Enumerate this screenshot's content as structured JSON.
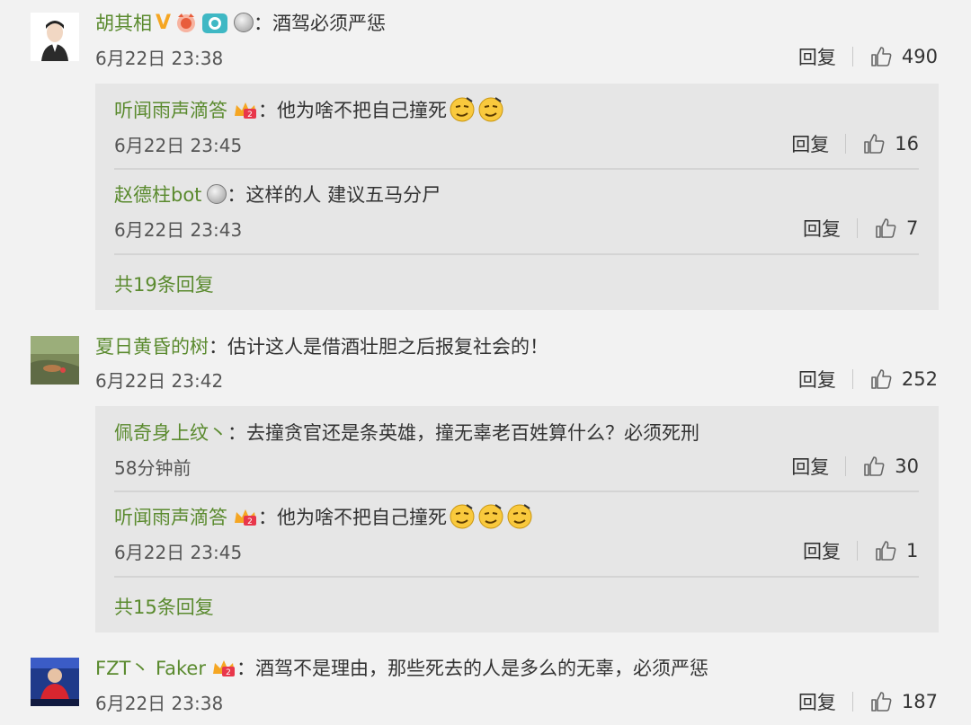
{
  "like_icon": "thumbs-up-icon",
  "colors": {
    "username": "#5a8a2e",
    "reply_box": "#e6e6e6",
    "background": "#f2f2f2",
    "v_badge": "#f5a623"
  },
  "comments": [
    {
      "username": "胡其相",
      "badges": [
        "v-verified-icon",
        "weibo-fan-icon",
        "camera-icon",
        "silver-medal-icon"
      ],
      "text": "酒驾必须严惩",
      "time": "6月22日 23:38",
      "reply_label": "回复",
      "likes": "490",
      "replies": [
        {
          "username": "听闻雨声滴答",
          "badge": "crown-badge-icon",
          "text": "他为啥不把自己撞死",
          "emojis": 2,
          "time": "6月22日 23:45",
          "reply_label": "回复",
          "likes": "16"
        },
        {
          "username": "赵德柱bot",
          "badge": "silver-medal-icon",
          "text": "这样的人 建议五马分尸",
          "emojis": 0,
          "time": "6月22日 23:43",
          "reply_label": "回复",
          "likes": "7"
        }
      ],
      "more_replies": "共19条回复"
    },
    {
      "username": "夏日黄昏的树",
      "badges": [],
      "text": "估计这人是借酒壮胆之后报复社会的！",
      "time": "6月22日 23:42",
      "reply_label": "回复",
      "likes": "252",
      "replies": [
        {
          "username": "佩奇身上纹丶",
          "badge": "",
          "text": "去撞贪官还是条英雄，撞无辜老百姓算什么？必须死刑",
          "emojis": 0,
          "time": "58分钟前",
          "reply_label": "回复",
          "likes": "30"
        },
        {
          "username": "听闻雨声滴答",
          "badge": "crown-badge-icon",
          "text": "他为啥不把自己撞死",
          "emojis": 3,
          "time": "6月22日 23:45",
          "reply_label": "回复",
          "likes": "1"
        }
      ],
      "more_replies": "共15条回复"
    },
    {
      "username": "FZT丶 Faker",
      "badges": [
        "crown-badge-icon"
      ],
      "text": "酒驾不是理由，那些死去的人是多么的无辜，必须严惩",
      "time": "6月22日 23:38",
      "reply_label": "回复",
      "likes": "187",
      "replies": [],
      "more_replies": ""
    }
  ]
}
